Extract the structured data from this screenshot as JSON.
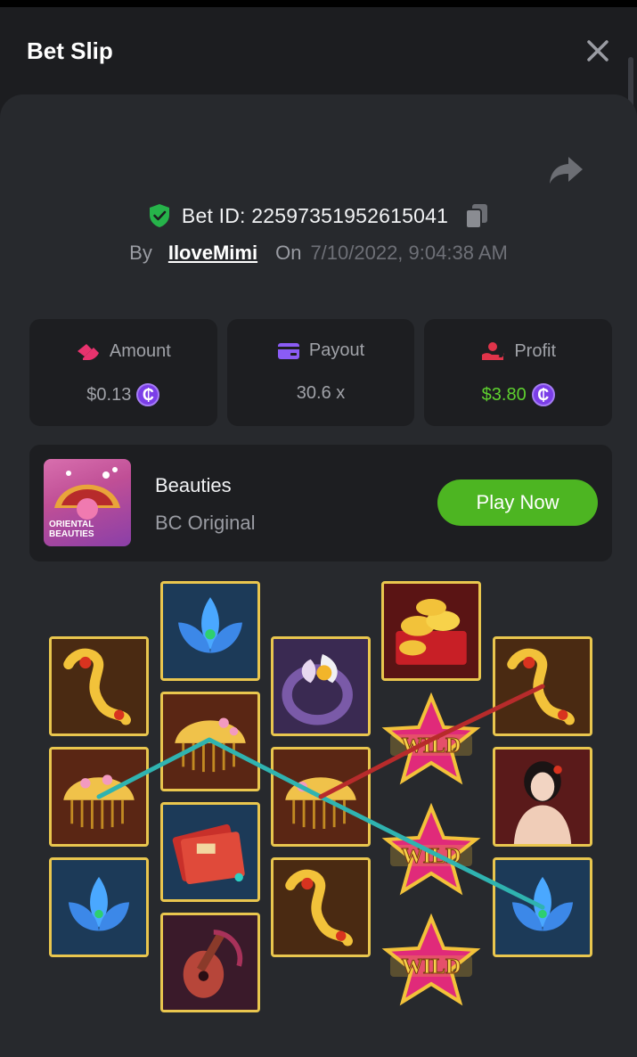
{
  "header": {
    "title": "Bet Slip"
  },
  "bet": {
    "id_text": "Bet ID: 22597351952615041",
    "by_label": "By",
    "username": "IloveMimi",
    "on_label": "On",
    "datetime": "7/10/2022, 9:04:38 AM"
  },
  "stats": {
    "amount": {
      "label": "Amount",
      "value": "$0.13"
    },
    "payout": {
      "label": "Payout",
      "value": "30.6 x"
    },
    "profit": {
      "label": "Profit",
      "value": "$3.80"
    }
  },
  "game": {
    "name": "Beauties",
    "provider": "BC Original",
    "play_label": "Play Now",
    "thumb_text_line1": "ORIENTAL",
    "thumb_text_line2": "BEAUTIES"
  },
  "symbols": {
    "wild_label": "WILD"
  },
  "colors": {
    "background": "#1c1d20",
    "panel": "#27292d",
    "card": "#1d1e21",
    "accent_green": "#4db522",
    "profit_green": "#5ed12f",
    "coin_purple": "#7b3ee8",
    "amount_icon": "#e8336e",
    "payout_icon": "#8b5cf6",
    "profit_icon": "#e0344a",
    "tile_border": "#e9c64e",
    "payline_teal": "#2fb3b0",
    "payline_red": "#b72b2b"
  },
  "icons": {
    "close": "close-icon",
    "share": "share-icon",
    "shield": "shield-check-icon",
    "copy": "copy-icon",
    "amount": "amount-icon",
    "payout": "payout-card-icon",
    "profit": "profit-hand-icon",
    "coin": "coin-icon"
  }
}
